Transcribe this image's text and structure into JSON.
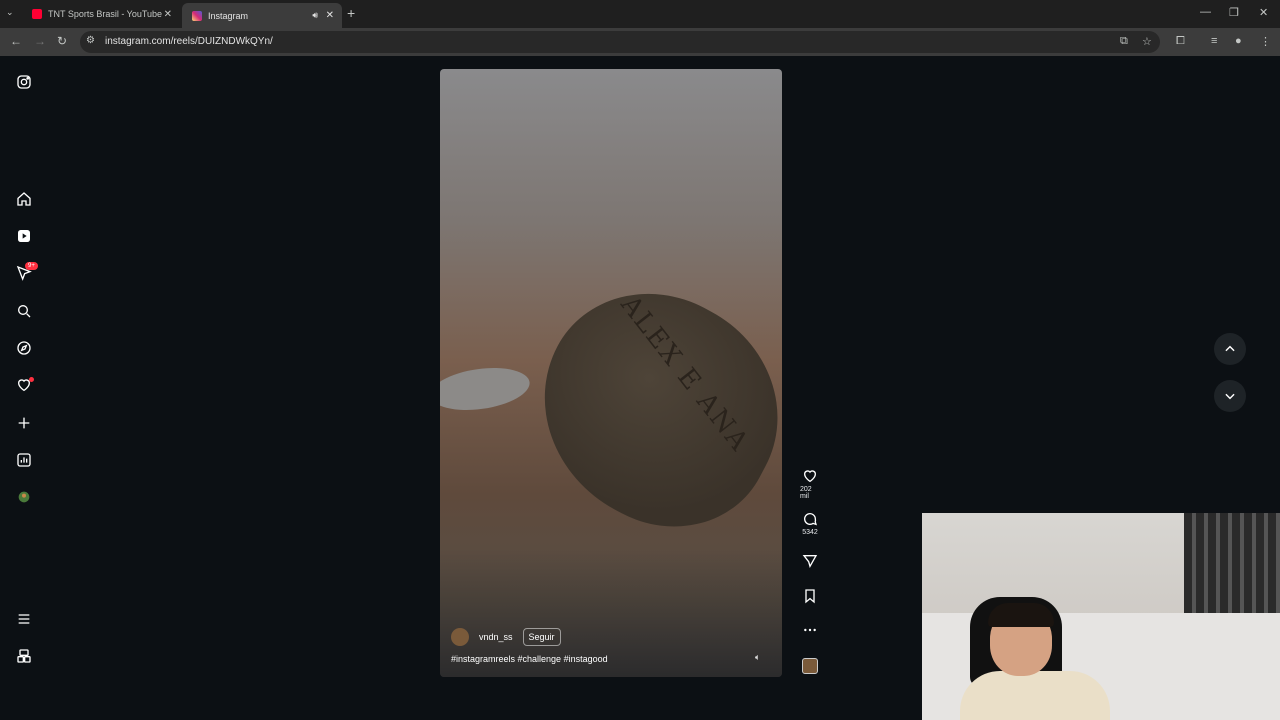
{
  "browser": {
    "tabs": [
      {
        "title": "TNT Sports Brasil - YouTube",
        "favicon_color": "#ff0033"
      },
      {
        "title": "Instagram",
        "favicon_color": "#d6249f"
      }
    ],
    "url": "instagram.com/reels/DUIZNDWkQYn/"
  },
  "sidebar": {
    "notifications_badge": "9+"
  },
  "reel": {
    "carving_text": "ALEX E ANA",
    "username": "vndn_ss",
    "follow_label": "Seguir",
    "caption": "#instagramreels #challenge #instagood",
    "likes": "202 mil",
    "comments": "5342"
  },
  "colors": {
    "page_bg": "#0c1014",
    "badge": "#ff3040",
    "chrome_tabbar": "#1f1f1f",
    "chrome_toolbar": "#3c3c3c"
  }
}
